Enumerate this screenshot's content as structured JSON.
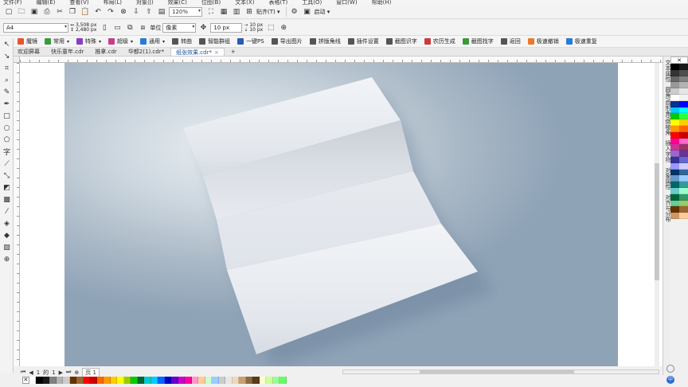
{
  "menu": [
    "文件(F)",
    "编辑(E)",
    "查看(V)",
    "布局(L)",
    "对象(J)",
    "效果(C)",
    "位图(B)",
    "文本(X)",
    "表格(T)",
    "工具(O)",
    "窗口(W)",
    "帮助(H)"
  ],
  "toolbar1": {
    "zoom_value": "120%",
    "snap_label": "贴齐(T)",
    "launch_label": "启动"
  },
  "toolbar2": {
    "page_size": "A4",
    "width": "3,508 px",
    "height": "2,480 px",
    "units_label": "单位",
    "units_value": "像素",
    "nudge": "10 px",
    "dup_x": "10 px",
    "dup_y": "10 px"
  },
  "plugin_bar": {
    "items": [
      {
        "label": "魔镜",
        "color": "#e8552a",
        "dropdown": false
      },
      {
        "label": "常用",
        "color": "#3c9a3c",
        "dropdown": true
      },
      {
        "label": "特殊",
        "color": "#8a3cc8",
        "dropdown": true
      },
      {
        "label": "超级",
        "color": "#c83c8a",
        "dropdown": true
      },
      {
        "label": "通用",
        "color": "#2a7ad8",
        "dropdown": true
      },
      {
        "label": "转曲",
        "color": "#555555",
        "dropdown": false
      },
      {
        "label": "智能群组",
        "color": "#555555",
        "dropdown": false
      },
      {
        "label": "一键PS",
        "color": "#2a5ab8",
        "dropdown": false
      },
      {
        "label": "导出图片",
        "color": "#555555",
        "dropdown": false
      },
      {
        "label": "拼版角线",
        "color": "#555555",
        "dropdown": false
      },
      {
        "label": "插件设置",
        "color": "#555555",
        "dropdown": false
      },
      {
        "label": "截图识字",
        "color": "#555555",
        "dropdown": false
      },
      {
        "label": "农历生成",
        "color": "#c83c3c",
        "dropdown": false
      },
      {
        "label": "截图找字",
        "color": "#3c9a3c",
        "dropdown": false
      },
      {
        "label": "返回",
        "color": "#555555",
        "dropdown": false
      },
      {
        "label": "极速撤销",
        "color": "#e87a2a",
        "dropdown": false
      },
      {
        "label": "极速重复",
        "color": "#2a7ad8",
        "dropdown": false
      }
    ]
  },
  "tabs": [
    {
      "label": "欢迎屏幕",
      "active": false,
      "closable": false
    },
    {
      "label": "快乐童年.cdr",
      "active": false,
      "closable": false
    },
    {
      "label": "推拿.cdr",
      "active": false,
      "closable": false
    },
    {
      "label": "华都2(1).cdr*",
      "active": false,
      "closable": false
    },
    {
      "label": "纸张效果.cdr*",
      "active": true,
      "closable": true
    }
  ],
  "page_nav": {
    "current": "1",
    "of_label": "的",
    "total": "1",
    "page_tab": "页 1"
  },
  "docker_tabs": [
    "文本属性",
    "圆角/扇形角/倒棱角",
    "插入字符",
    "对象属性",
    "对齐与分布"
  ],
  "palette_colors": [
    "#000000",
    "#1a1a1a",
    "#333333",
    "#4d4d4d",
    "#666666",
    "#808080",
    "#999999",
    "#b3b3b3",
    "#cccccc",
    "#e6e6e6",
    "#ffffff",
    "#f2f2f2",
    "#003399",
    "#0000ff",
    "#00ccff",
    "#00ffff",
    "#00cc00",
    "#33ff33",
    "#ffff00",
    "#ffcc00",
    "#ff9900",
    "#ff6600",
    "#ff0000",
    "#cc0000",
    "#ff0099",
    "#ff66cc",
    "#cc3399",
    "#993366",
    "#9966cc",
    "#663399",
    "#333399",
    "#6666cc",
    "#9999ff",
    "#ccccff",
    "#003366",
    "#336699",
    "#6699cc",
    "#99ccff",
    "#006666",
    "#339999",
    "#66cccc",
    "#99ffcc",
    "#006633",
    "#339966",
    "#66cc99",
    "#99cc66",
    "#663300",
    "#996633",
    "#cc9966",
    "#ffcc99"
  ],
  "bottom_palette": [
    "#ffffff",
    "#000000",
    "#1a1a1a",
    "#808080",
    "#b3b3b3",
    "#cccccc",
    "#663300",
    "#996633",
    "#ff0000",
    "#cc0000",
    "#ff6600",
    "#ff9900",
    "#ffcc00",
    "#ffff00",
    "#99cc00",
    "#00cc00",
    "#006633",
    "#00cccc",
    "#00ccff",
    "#0066ff",
    "#0000cc",
    "#6600cc",
    "#cc00cc",
    "#ff0099",
    "#ff99cc",
    "#ffcc99",
    "#ccffcc",
    "#99ccff",
    "#cccccc",
    "#e6e6e6",
    "#f0d9b5",
    "#c8a070",
    "#8c6a40",
    "#5a3a1a",
    "#ffffcc",
    "#ccff99",
    "#99ff99",
    "#66ff66"
  ],
  "palette_top_label": "✕",
  "bottom_right_label": "中"
}
